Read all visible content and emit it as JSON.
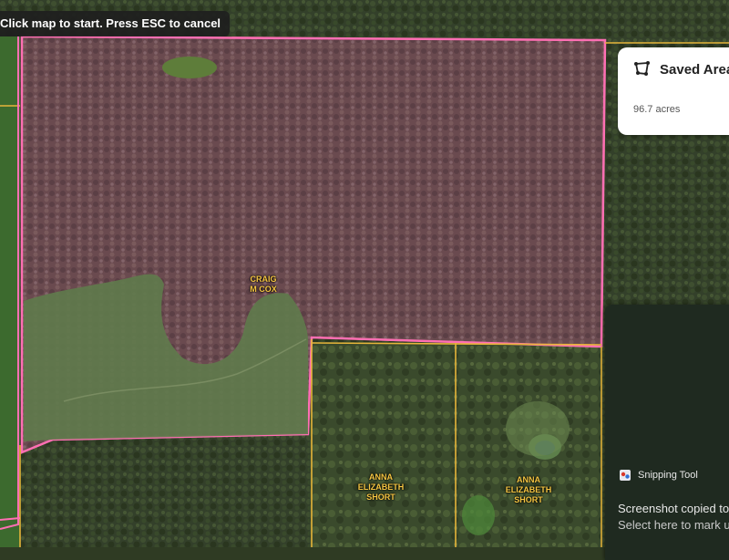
{
  "banner": {
    "text": "Click map to start. Press ESC to cancel"
  },
  "parcels": [
    {
      "label": "CRAIG\nM COX"
    },
    {
      "label": "ANNA\nELIZABETH\nSHORT"
    },
    {
      "label": "ANNA\nELIZABETH\nSHORT"
    }
  ],
  "saved_area": {
    "title": "Saved Area",
    "acres": "96.7 acres",
    "icon": "polygon-icon"
  },
  "toast": {
    "app_name": "Snipping Tool",
    "message": "Screenshot copied to",
    "subtext": "Select here to mark up",
    "icon": "snipping-tool-icon"
  },
  "colors": {
    "boundary": "#ff6fb3",
    "parcel_line": "#e6b53a",
    "selection_fill": "#7a4f6e"
  }
}
